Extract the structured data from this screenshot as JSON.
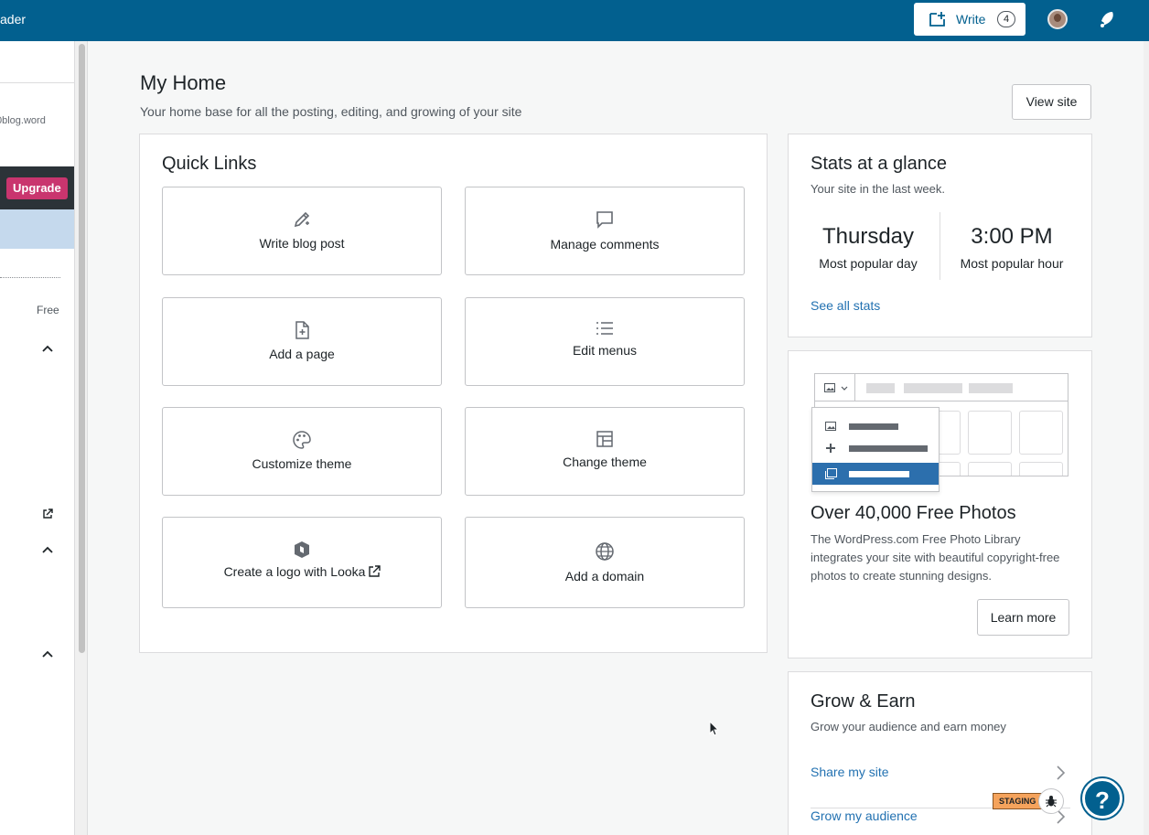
{
  "masterbar": {
    "reader_label": "ader",
    "write_label": "Write",
    "write_count": "4"
  },
  "sidebar": {
    "site_url": "0blog.word",
    "upgrade_label": "Upgrade",
    "plan_label": "Free"
  },
  "page": {
    "title": "My Home",
    "subtitle": "Your home base for all the posting, editing, and growing of your site",
    "view_site_label": "View site"
  },
  "quick_links": {
    "title": "Quick Links",
    "items": [
      {
        "label": "Write blog post",
        "icon": "edit-pencil-icon"
      },
      {
        "label": "Manage comments",
        "icon": "comment-icon"
      },
      {
        "label": "Add a page",
        "icon": "add-page-icon"
      },
      {
        "label": "Edit menus",
        "icon": "menu-list-icon"
      },
      {
        "label": "Customize theme",
        "icon": "palette-icon"
      },
      {
        "label": "Change theme",
        "icon": "layout-icon"
      },
      {
        "label": "Create a logo with Looka",
        "icon": "looka-logo-icon"
      },
      {
        "label": "Add a domain",
        "icon": "globe-icon"
      }
    ]
  },
  "stats": {
    "title": "Stats at a glance",
    "subtitle": "Your site in the last week.",
    "popular_day_value": "Thursday",
    "popular_day_label": "Most popular day",
    "popular_hour_value": "3:00 PM",
    "popular_hour_label": "Most popular hour",
    "see_all_label": "See all stats"
  },
  "photos": {
    "title": "Over 40,000 Free Photos",
    "description": "The WordPress.com Free Photo Library integrates your site with beautiful copyright-free photos to create stunning designs.",
    "learn_more_label": "Learn more"
  },
  "grow": {
    "title": "Grow & Earn",
    "subtitle": "Grow your audience and earn money",
    "links": [
      "Share my site",
      "Grow my audience"
    ]
  },
  "staging_badge": "STAGING",
  "help_label": "?",
  "colors": {
    "masterbar": "#02608f",
    "link": "#2271b1",
    "upgrade": "#c9356e",
    "staging": "#f5a35c"
  }
}
